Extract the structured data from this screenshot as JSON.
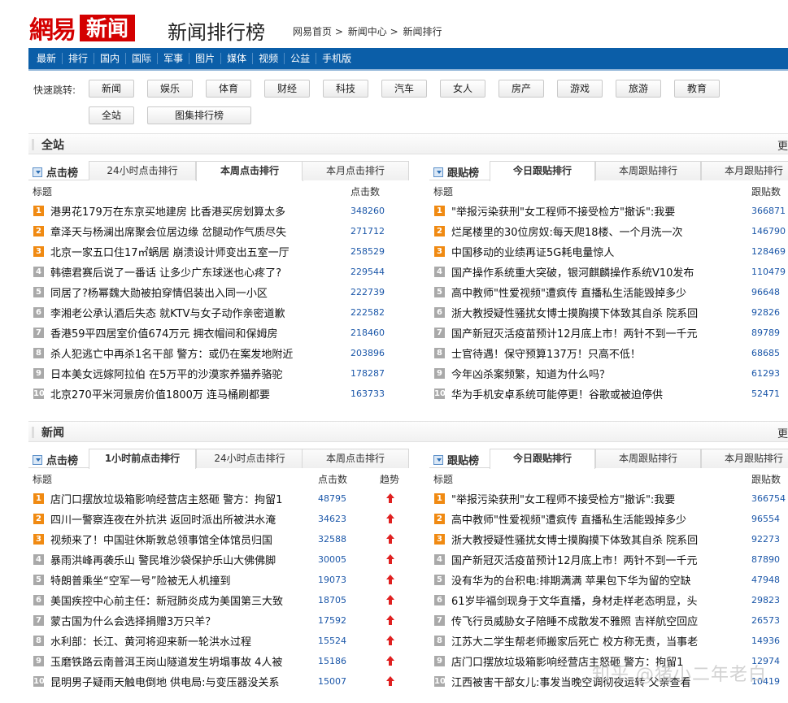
{
  "header": {
    "logo_main": "網易",
    "logo_box": "新闻",
    "page_title": "新闻排行榜",
    "breadcrumb": [
      "网易首页",
      "新闻中心",
      "新闻排行"
    ],
    "breadcrumb_sep": ">"
  },
  "nav": [
    "最新",
    "排行",
    "国内",
    "国际",
    "军事",
    "图片",
    "媒体",
    "视频",
    "公益",
    "手机版"
  ],
  "quick_jump": {
    "label": "快速跳转:",
    "row1": [
      "新闻",
      "娱乐",
      "体育",
      "财经",
      "科技",
      "汽车",
      "女人",
      "房产",
      "游戏",
      "旅游",
      "教育"
    ],
    "row2": [
      "全站",
      "图集排行榜"
    ]
  },
  "sections": {
    "all": {
      "title": "全站",
      "more": "更"
    },
    "news": {
      "title": "新闻",
      "more": "更"
    }
  },
  "all_click": {
    "panel_title": "点击榜",
    "tabs": [
      "24小时点击排行",
      "本周点击排行",
      "本月点击排行"
    ],
    "active_tab": 1,
    "col_title": "标题",
    "col_num": "点击数",
    "rows": [
      {
        "rank": "1",
        "title": "港男花179万在东京买地建房 比香港买房划算太多",
        "num": "348260"
      },
      {
        "rank": "2",
        "title": "章泽天与杨澜出席聚会位居边缘 岔腿动作气质尽失",
        "num": "271712"
      },
      {
        "rank": "3",
        "title": "北京一家五口住17㎡蜗居 崩溃设计师变出五室一厅",
        "num": "258529"
      },
      {
        "rank": "4",
        "title": "韩德君赛后说了一番话 让多少广东球迷也心疼了?",
        "num": "229544"
      },
      {
        "rank": "5",
        "title": "同居了?杨幂魏大勋被拍穿情侣装出入同一小区",
        "num": "222739"
      },
      {
        "rank": "6",
        "title": "李湘老公承认酒后失态 就KTV与女子动作亲密道歉",
        "num": "222582"
      },
      {
        "rank": "7",
        "title": "香港59平四居室价值674万元 拥衣帽间和保姆房",
        "num": "218460"
      },
      {
        "rank": "8",
        "title": "杀人犯逃亡中再杀1名干部 警方：或仍在案发地附近",
        "num": "203896"
      },
      {
        "rank": "9",
        "title": "日本美女远嫁阿拉伯 在5万平的沙漠家养猫养骆驼",
        "num": "178287"
      },
      {
        "rank": "10",
        "title": "北京270平米河景房价值1800万 连马桶刷都要",
        "num": "163733"
      }
    ]
  },
  "all_reply": {
    "panel_title": "跟贴榜",
    "tabs": [
      "今日跟贴排行",
      "本周跟贴排行",
      "本月跟贴排行"
    ],
    "active_tab": 0,
    "col_title": "标题",
    "col_num": "跟贴数",
    "rows": [
      {
        "rank": "1",
        "title": "\"举报污染获刑\"女工程师不接受检方\"撤诉\":我要",
        "num": "366871"
      },
      {
        "rank": "2",
        "title": "烂尾楼里的30位房奴:每天爬18楼、一个月洗一次",
        "num": "146790"
      },
      {
        "rank": "3",
        "title": "中国移动的业绩再证5G耗电量惊人",
        "num": "128469"
      },
      {
        "rank": "4",
        "title": "国产操作系统重大突破，银河麒麟操作系统V10发布",
        "num": "110479"
      },
      {
        "rank": "5",
        "title": "高中教师\"性爱视频\"遭疯传 直播私生活能毁掉多少",
        "num": "96648"
      },
      {
        "rank": "6",
        "title": "浙大教授疑性骚扰女博士摸胸摸下体致其自杀 院系回",
        "num": "92826"
      },
      {
        "rank": "7",
        "title": "国产新冠灭活疫苗预计12月底上市！两针不到一千元",
        "num": "89789"
      },
      {
        "rank": "8",
        "title": "士官待遇！保守预算137万！只高不低！",
        "num": "68685"
      },
      {
        "rank": "9",
        "title": "今年凶杀案频繁，知道为什么吗？",
        "num": "61293"
      },
      {
        "rank": "10",
        "title": "华为手机安卓系统可能停更！谷歌或被迫停供",
        "num": "52471"
      }
    ]
  },
  "news_click": {
    "panel_title": "点击榜",
    "tabs": [
      "1小时前点击排行",
      "24小时点击排行",
      "本周点击排行"
    ],
    "active_tab": 0,
    "col_title": "标题",
    "col_num": "点击数",
    "col_trend": "趋势",
    "rows": [
      {
        "rank": "1",
        "title": "店门口摆放垃圾箱影响经营店主怒砸 警方：拘留1",
        "num": "48795"
      },
      {
        "rank": "2",
        "title": "四川一警察连夜在外抗洪 返回时派出所被洪水淹",
        "num": "34623"
      },
      {
        "rank": "3",
        "title": "视频来了！中国驻休斯敦总领事馆全体馆员归国",
        "num": "32588"
      },
      {
        "rank": "4",
        "title": "暴雨洪峰再袭乐山 警民堆沙袋保护乐山大佛佛脚",
        "num": "30005"
      },
      {
        "rank": "5",
        "title": "特朗普乘坐“空军一号”险被无人机撞到",
        "num": "19073"
      },
      {
        "rank": "6",
        "title": "美国疾控中心前主任：新冠肺炎成为美国第三大致",
        "num": "18705"
      },
      {
        "rank": "7",
        "title": "蒙古国为什么会选择捐赠3万只羊？",
        "num": "17592"
      },
      {
        "rank": "8",
        "title": "水利部：长江、黄河将迎来新一轮洪水过程",
        "num": "15524"
      },
      {
        "rank": "9",
        "title": "玉磨铁路云南普洱王岗山隧道发生坍塌事故 4人被",
        "num": "15186"
      },
      {
        "rank": "10",
        "title": "昆明男子疑雨天触电倒地 供电局:与变压器没关系",
        "num": "15007"
      }
    ]
  },
  "news_reply": {
    "panel_title": "跟贴榜",
    "tabs": [
      "今日跟贴排行",
      "本周跟贴排行",
      "本月跟贴排行"
    ],
    "active_tab": 0,
    "col_title": "标题",
    "col_num": "跟贴数",
    "rows": [
      {
        "rank": "1",
        "title": "\"举报污染获刑\"女工程师不接受检方\"撤诉\":我要",
        "num": "366754"
      },
      {
        "rank": "2",
        "title": "高中教师\"性爱视频\"遭疯传 直播私生活能毁掉多少",
        "num": "96554"
      },
      {
        "rank": "3",
        "title": "浙大教授疑性骚扰女博士摸胸摸下体致其自杀 院系回",
        "num": "92273"
      },
      {
        "rank": "4",
        "title": "国产新冠灭活疫苗预计12月底上市！两针不到一千元",
        "num": "87890"
      },
      {
        "rank": "5",
        "title": "没有华为的台积电:排期满满 苹果包下华为留的空缺",
        "num": "47948"
      },
      {
        "rank": "6",
        "title": "61岁毕福剑现身于文华直播，身材走样老态明显，头",
        "num": "29823"
      },
      {
        "rank": "7",
        "title": "传飞行员威胁女子陪睡不成散发不雅照 吉祥航空回应",
        "num": "26573"
      },
      {
        "rank": "8",
        "title": "江苏大二学生帮老师搬家后死亡 校方称无责，当事老",
        "num": "14936"
      },
      {
        "rank": "9",
        "title": "店门口摆放垃圾箱影响经营店主怒砸 警方：拘留1",
        "num": "12974"
      },
      {
        "rank": "10",
        "title": "江西被害干部女儿:事发当晚空调彻夜运转 父亲查看",
        "num": "10419"
      }
    ]
  },
  "watermark": "知乎 @猪小二年老白",
  "colors": {
    "nav_bg": "#0b5ea8",
    "brand_red": "#d40000",
    "rank_top": "#f08a12",
    "rank_other": "#a9a9a9",
    "number_blue": "#1a56a8",
    "trend_up": "#e02020"
  }
}
